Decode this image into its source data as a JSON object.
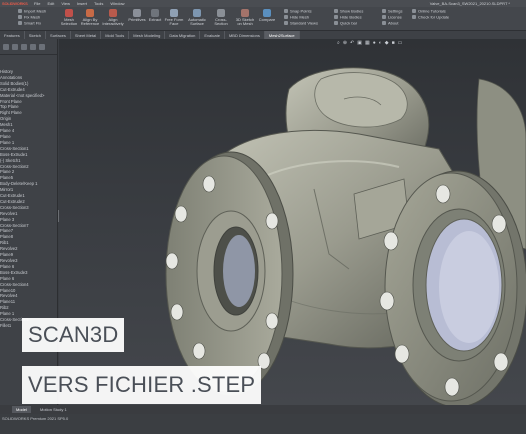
{
  "titlebar": {
    "app_logo": "SOLIDWORKS",
    "menu": [
      "File",
      "Edit",
      "View",
      "Insert",
      "Tools",
      "Window"
    ],
    "document_title": "Valve_BA-Scan3_SW2021_20210.SLDPRT *"
  },
  "ribbon": {
    "small_left": [
      "Import Mesh",
      "Fix Mesh",
      "Smart Fix",
      "Surface Repair"
    ],
    "buttons": [
      {
        "label": "Mesh Selection"
      },
      {
        "label": "Align By Reference"
      },
      {
        "label": "Align Interactively"
      },
      {
        "label": "Primitives"
      },
      {
        "label": "Extract"
      },
      {
        "label": "Free Form Face"
      },
      {
        "label": "Automatic Surface"
      },
      {
        "label": "Cross-Section"
      },
      {
        "label": "3D Sketch on Mesh"
      },
      {
        "label": "Compare"
      }
    ],
    "small_right": [
      "Snap Points",
      "Hide Mesh",
      "Standard Views",
      "Show Bodies",
      "Hide Bodies",
      "Quick bar",
      "Settings",
      "License",
      "About",
      "Online Tutorials",
      "Check for Update"
    ]
  },
  "tabs": [
    "Features",
    "Sketch",
    "Surfaces",
    "Sheet Metal",
    "Mold Tools",
    "Mesh Modeling",
    "Data Migration",
    "Evaluate",
    "MBD Dimensions",
    "Mesh2Surface"
  ],
  "active_tab": "Mesh2Surface",
  "tree": [
    "History",
    "Annotations",
    "Solid Bodies(1)",
    "Cut-Extrude4",
    "Material <not specified>",
    "Front Plane",
    "Top Plane",
    "Right Plane",
    "Origin",
    "Mesh1",
    "Plane 4",
    "Plane",
    "Plane 1",
    "Cross-Section1",
    "Boss-Extrude1",
    "(-) Sketch1",
    "Cross-Section2",
    "Plane 2",
    "Plane5",
    "Body-Delete/Keep 1",
    "Mirror1",
    "Cut-Extrude1",
    "Cut-Extrude2",
    "Cross-Section3",
    "Revolve1",
    "Plane 3",
    "Cross-Section7",
    "Plane7",
    "Plane8",
    "Rib1",
    "Revolve2",
    "Plane9",
    "Revolve3",
    "Plane 6",
    "Boss-Extrude3",
    "Plane 6",
    "Cross-Section4",
    "Plane10",
    "Revolve4",
    "Plane11",
    "Rib2",
    "Plane 1",
    "Cross-Section5",
    "Fillet1"
  ],
  "bottom_tabs": [
    "Model",
    "Motion Study 1"
  ],
  "status_text": "SOLIDWORKS Premium 2021 SP5.0",
  "overlay": {
    "line1": "SCAN3D",
    "line2": "VERS FICHIER .STEP"
  },
  "colors": {
    "accent_red": "#e05a4a",
    "part_body": "#9a9b8e",
    "caption_bg": "#ffffff",
    "caption_text": "#4a4f57"
  }
}
